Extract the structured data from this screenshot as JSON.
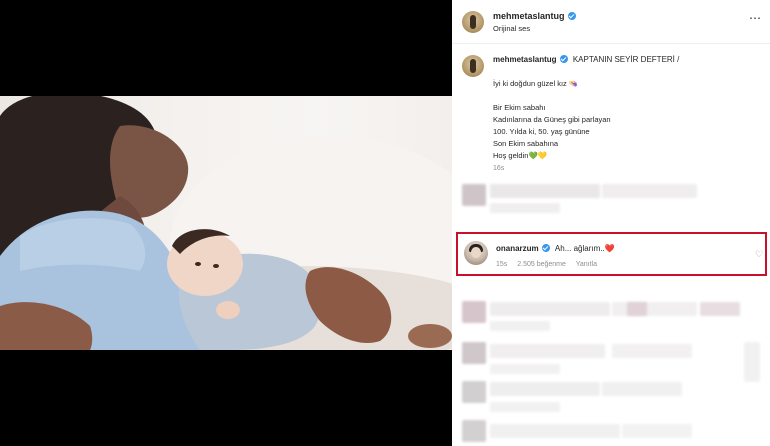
{
  "post": {
    "username": "mehmetaslantug",
    "audio_label": "Orijinal ses",
    "close_symbol": "⋮"
  },
  "caption": {
    "username": "mehmetaslantug",
    "title": "KAPTANIN SEYİR DEFTERİ /",
    "lines": [
      "İyi ki doğdun güzel kız 👒",
      "Bir Ekim sabahı",
      "Kadınlarına da Güneş gibi parlayan",
      "100. Yılda ki, 50. yaş gününe",
      "Son Ekim sabahına",
      "Hoş geldin💚💛"
    ],
    "time": "16s"
  },
  "highlighted_comment": {
    "username": "onanarzum",
    "text": "Ah... ağlarım..❤️",
    "time": "15s",
    "likes": "2.505 beğenme",
    "reply": "Yanıtla"
  },
  "colors": {
    "accent": "#3897f0",
    "highlight_border": "#c8102e"
  }
}
